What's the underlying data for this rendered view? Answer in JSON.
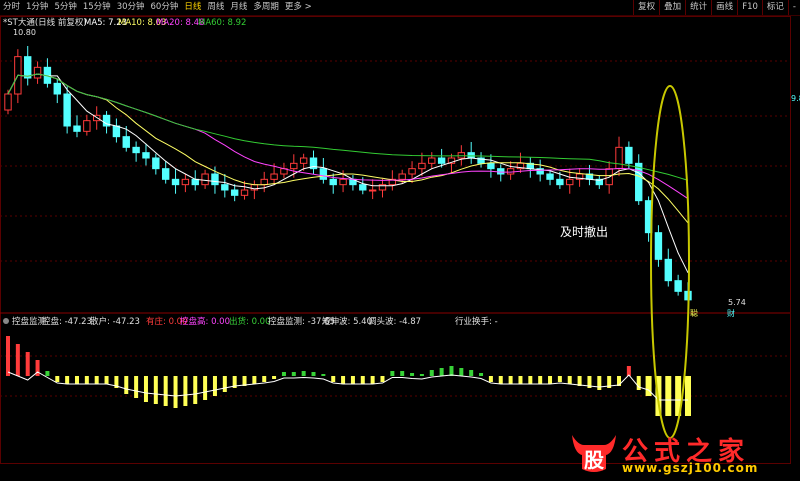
{
  "toolbar": {
    "periods": [
      "分时",
      "1分钟",
      "5分钟",
      "15分钟",
      "30分钟",
      "60分钟",
      "日线",
      "周线",
      "月线",
      "多周期",
      "更多 >"
    ],
    "active_period": "日线",
    "tools": [
      "复权",
      "叠加",
      "统计",
      "画线",
      "F10",
      "标记",
      "-"
    ]
  },
  "main": {
    "title": "*ST大通(日线 前复权)",
    "ma5_label": "MA5: 7.23",
    "ma10_label": "MA10: 8.03",
    "ma20_label": "MA20: 8.48",
    "ma60_label": "MA60: 8.92",
    "high_price": "10.80",
    "low_price": "5.74",
    "annotation": "及时撤出",
    "tag_right": "9.8",
    "tag_bottom": "财",
    "tag_mid": "聪"
  },
  "indicator": {
    "name": "控盘监测",
    "items": [
      {
        "label": "控盘: -47.23",
        "color": "#e0e0e0"
      },
      {
        "label": "散户: -47.23",
        "color": "#e0e0e0"
      },
      {
        "label": "有庄: 0.00",
        "color": "#ff3b3b"
      },
      {
        "label": "控盘高: 0.00",
        "color": "#ff44ff"
      },
      {
        "label": "出货: 0.00",
        "color": "#38d238"
      },
      {
        "label": "控盘监测: -37.65",
        "color": "#e0e0e0"
      },
      {
        "label": "短伸波: 5.40",
        "color": "#e0e0e0"
      },
      {
        "label": "调头波: -4.87",
        "color": "#e0e0e0"
      }
    ],
    "industry": "行业换手: -"
  },
  "watermark": {
    "big": "公式之家",
    "url": "www.gszj100.com",
    "logo_char": "股"
  },
  "colors": {
    "up": "#ff3b3b",
    "down": "#54ffff",
    "ma5": "#ffffff",
    "ma10": "#ffff66",
    "ma20": "#ff44ff",
    "ma60": "#33cc33",
    "grid": "#5a0000",
    "yellow_bar": "#ffff55",
    "ellipse": "#c8c800"
  },
  "chart_data": {
    "type": "candlestick",
    "candles_close": [
      9.6,
      10.3,
      9.9,
      10.1,
      9.8,
      9.6,
      9.0,
      8.9,
      9.1,
      9.2,
      9.0,
      8.8,
      8.6,
      8.5,
      8.4,
      8.2,
      8.0,
      7.9,
      8.0,
      7.9,
      8.1,
      7.9,
      7.8,
      7.7,
      7.8,
      7.9,
      8.0,
      8.1,
      8.2,
      8.3,
      8.4,
      8.2,
      8.0,
      7.9,
      8.0,
      7.9,
      7.8,
      7.8,
      7.9,
      8.0,
      8.1,
      8.2,
      8.3,
      8.4,
      8.3,
      8.4,
      8.5,
      8.4,
      8.3,
      8.2,
      8.1,
      8.2,
      8.3,
      8.2,
      8.1,
      8.0,
      7.9,
      8.0,
      8.1,
      8.0,
      7.9,
      8.2,
      8.6,
      8.3,
      7.6,
      7.0,
      6.5,
      6.1,
      5.9,
      5.74
    ]
  }
}
